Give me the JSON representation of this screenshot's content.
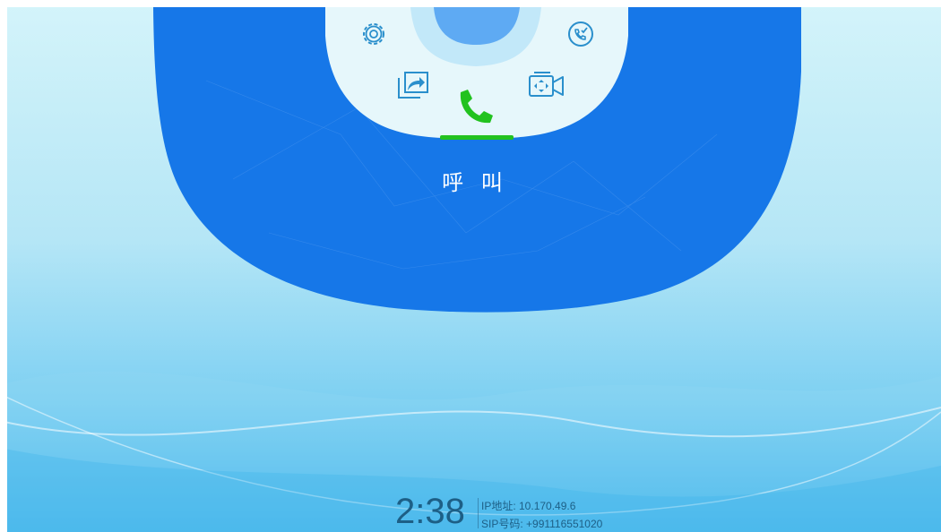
{
  "menu": {
    "items": [
      {
        "name": "settings",
        "icon": "gear-icon"
      },
      {
        "name": "call-history",
        "icon": "phone-check-icon"
      },
      {
        "name": "screen-share",
        "icon": "share-screen-icon"
      },
      {
        "name": "call",
        "icon": "phone-icon"
      },
      {
        "name": "video-conference",
        "icon": "video-camera-icon"
      }
    ],
    "selected_label": "呼 叫"
  },
  "status": {
    "time": "2:38",
    "ip_text": "IP地址: 10.170.49.6",
    "sip_text": "SIP号码: +991116551020"
  },
  "colors": {
    "panel_blue": "#1677e8",
    "inner_panel": "#e6f7fb",
    "icon_stroke": "#2a8fcc",
    "call_green": "#22c21f",
    "text_dark": "#1d5f86"
  }
}
